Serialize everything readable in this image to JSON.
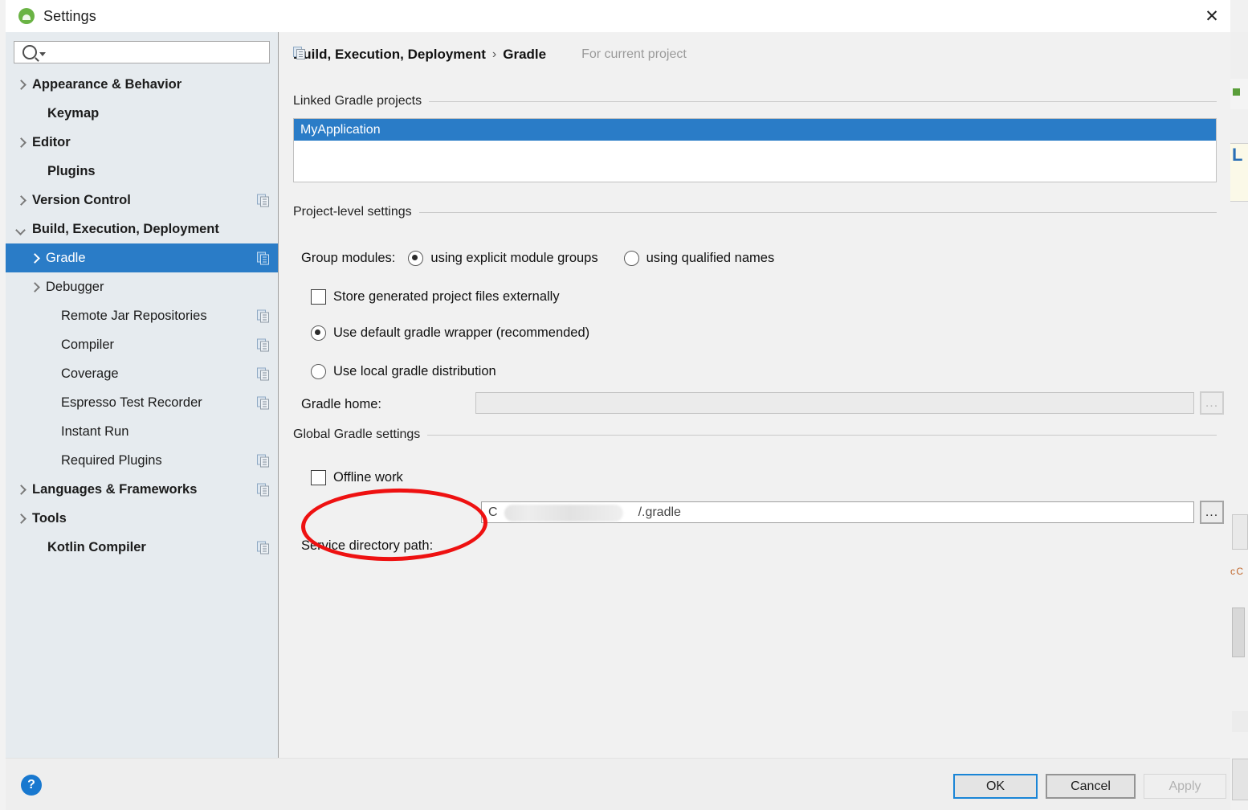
{
  "window": {
    "title": "Settings",
    "app_icon": "android-studio-icon",
    "close_icon": "close-icon"
  },
  "sidebar": {
    "search": {
      "placeholder": "",
      "value": "",
      "icon": "search-icon",
      "dropdown_icon": "caret-down-icon"
    },
    "items": [
      {
        "label": "Appearance & Behavior",
        "arrow": "right",
        "bold": true,
        "indent": 14,
        "badge": false,
        "selected": false
      },
      {
        "label": "Keymap",
        "arrow": "none",
        "bold": true,
        "indent": 33,
        "badge": false,
        "selected": false
      },
      {
        "label": "Editor",
        "arrow": "right",
        "bold": true,
        "indent": 14,
        "badge": false,
        "selected": false
      },
      {
        "label": "Plugins",
        "arrow": "none",
        "bold": true,
        "indent": 33,
        "badge": false,
        "selected": false
      },
      {
        "label": "Version Control",
        "arrow": "right",
        "bold": true,
        "indent": 14,
        "badge": true,
        "selected": false
      },
      {
        "label": "Build, Execution, Deployment",
        "arrow": "down",
        "bold": true,
        "indent": 14,
        "badge": false,
        "selected": false
      },
      {
        "label": "Gradle",
        "arrow": "right",
        "bold": false,
        "indent": 31,
        "badge": true,
        "selected": true
      },
      {
        "label": "Debugger",
        "arrow": "right",
        "bold": false,
        "indent": 31,
        "badge": false,
        "selected": false
      },
      {
        "label": "Remote Jar Repositories",
        "arrow": "none",
        "bold": false,
        "indent": 50,
        "badge": true,
        "selected": false
      },
      {
        "label": "Compiler",
        "arrow": "none",
        "bold": false,
        "indent": 50,
        "badge": true,
        "selected": false
      },
      {
        "label": "Coverage",
        "arrow": "none",
        "bold": false,
        "indent": 50,
        "badge": true,
        "selected": false
      },
      {
        "label": "Espresso Test Recorder",
        "arrow": "none",
        "bold": false,
        "indent": 50,
        "badge": true,
        "selected": false
      },
      {
        "label": "Instant Run",
        "arrow": "none",
        "bold": false,
        "indent": 50,
        "badge": false,
        "selected": false
      },
      {
        "label": "Required Plugins",
        "arrow": "none",
        "bold": false,
        "indent": 50,
        "badge": true,
        "selected": false
      },
      {
        "label": "Languages & Frameworks",
        "arrow": "right",
        "bold": true,
        "indent": 14,
        "badge": true,
        "selected": false
      },
      {
        "label": "Tools",
        "arrow": "right",
        "bold": true,
        "indent": 14,
        "badge": false,
        "selected": false
      },
      {
        "label": "Kotlin Compiler",
        "arrow": "none",
        "bold": true,
        "indent": 33,
        "badge": true,
        "selected": false
      }
    ]
  },
  "content": {
    "breadcrumb": {
      "parent": "Build, Execution, Deployment",
      "separator": "›",
      "current": "Gradle",
      "scope_label": "For current project",
      "scope_icon": "project-scope-icon"
    },
    "linked_projects": {
      "title": "Linked Gradle projects",
      "rows": [
        {
          "label": "MyApplication",
          "selected": true
        }
      ]
    },
    "project_level": {
      "title": "Project-level settings",
      "group_modules_label": "Group modules:",
      "group_modules_options": [
        {
          "label": "using explicit module groups",
          "checked": true
        },
        {
          "label": "using qualified names",
          "checked": false
        }
      ],
      "store_generated_label": "Store generated project files externally",
      "store_generated_checked": false,
      "distribution_options": [
        {
          "label": "Use default gradle wrapper (recommended)",
          "checked": true
        },
        {
          "label": "Use local gradle distribution",
          "checked": false
        }
      ],
      "gradle_home_label": "Gradle home:",
      "gradle_home_value": "",
      "gradle_home_enabled": false,
      "browse_label": "..."
    },
    "global_settings": {
      "title": "Global Gradle settings",
      "offline_label": "Offline work",
      "offline_checked": false,
      "service_dir_label": "Service directory path:",
      "service_dir_value": "C",
      "service_dir_suffix": "/.gradle",
      "browse_label": "..."
    },
    "annotation": {
      "shape": "red-ellipse",
      "color": "#ee1111",
      "targets": "Service directory path:"
    }
  },
  "footer": {
    "help_label": "?",
    "ok_label": "OK",
    "cancel_label": "Cancel",
    "apply_label": "Apply",
    "apply_enabled": false
  }
}
